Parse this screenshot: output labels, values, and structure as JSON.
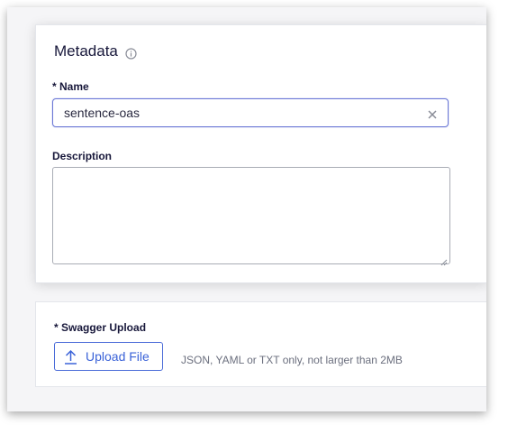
{
  "metadata": {
    "title": "Metadata",
    "name_label": "* Name",
    "name_value": "sentence-oas",
    "description_label": "Description",
    "description_value": ""
  },
  "upload": {
    "label": "* Swagger Upload",
    "button_label": "Upload File",
    "hint": "JSON, YAML or TXT only, not larger than 2MB"
  },
  "colors": {
    "accent": "#3a62d8",
    "text_dark": "#17173a",
    "hint_text": "#6b6f7e"
  },
  "icons": [
    "info-icon",
    "clear-icon",
    "upload-icon"
  ]
}
